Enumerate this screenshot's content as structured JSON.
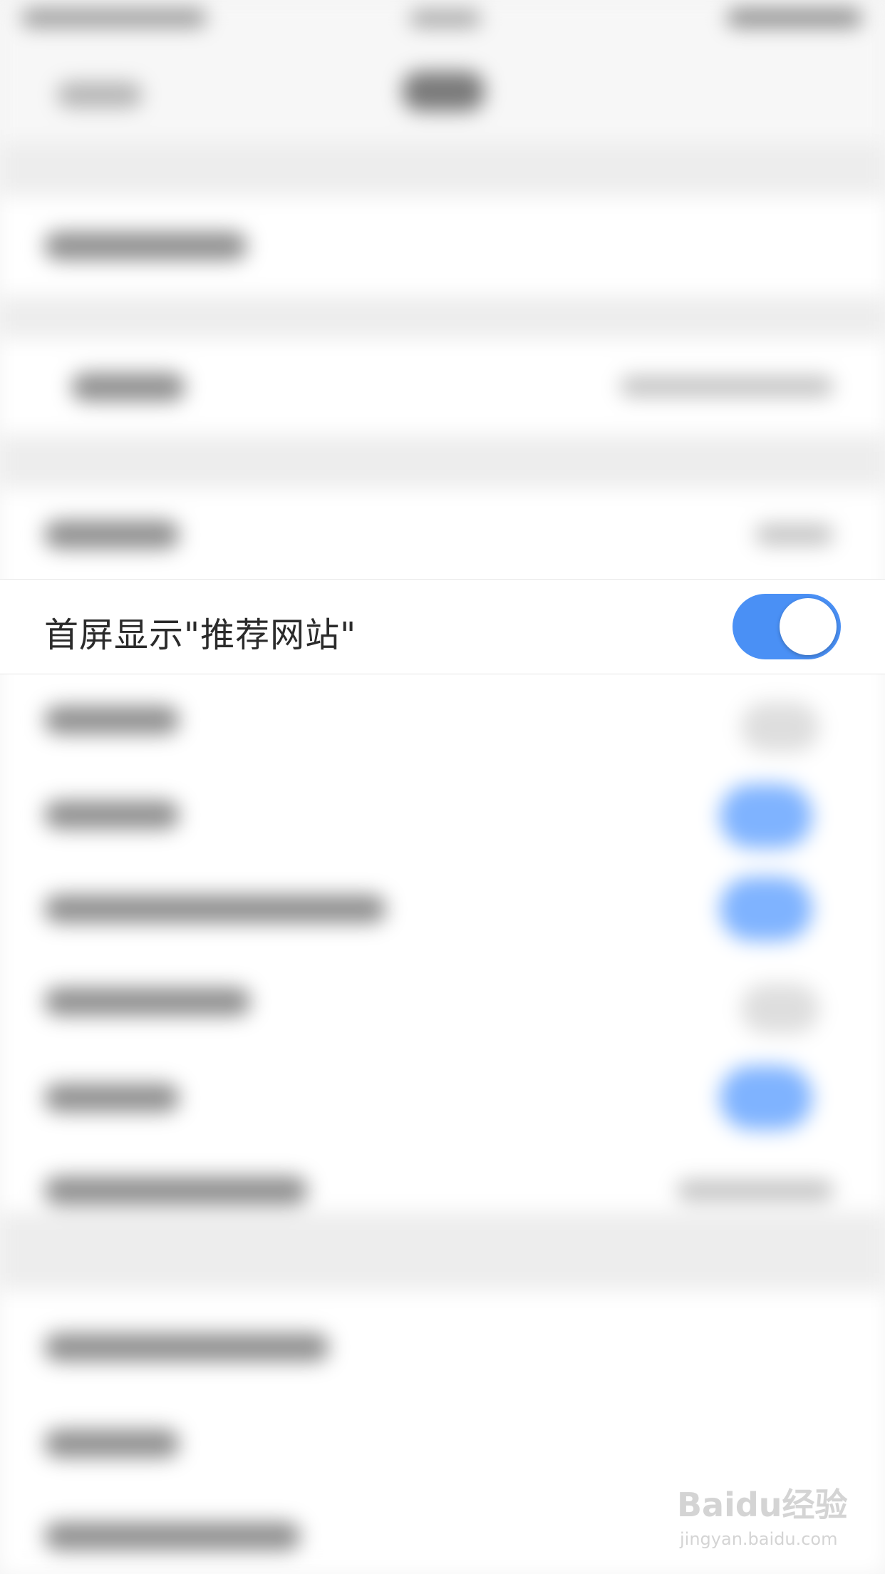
{
  "setting_row": {
    "label": "首屏显示\"推荐网站\"",
    "toggle_state": "on"
  },
  "colors": {
    "toggle_on": "#4a90f5",
    "label": "#2b2b2b"
  },
  "watermark": {
    "logo_text": "Baidu经验",
    "url_text": "jingyan.baidu.com"
  },
  "icons": [
    "toggle-switch"
  ]
}
